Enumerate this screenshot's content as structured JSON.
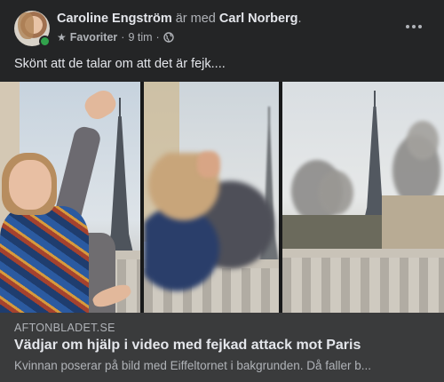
{
  "post": {
    "author": "Caroline Engström",
    "with_text": " är med ",
    "tagged": "Carl Norberg",
    "period": ".",
    "favorite_label": "Favoriter",
    "separator": "·",
    "time": "9 tim",
    "text": "Skönt att de talar om att det är fejk....",
    "online": true
  },
  "link_preview": {
    "domain": "AFTONBLADET.SE",
    "title": "Vädjar om hjälp i video med fejkad attack mot Paris",
    "description": "Kvinnan poserar på bild med Eiffeltornet i bakgrunden. Då faller b..."
  },
  "icons": {
    "favorite": "star-icon",
    "audience": "globe-icon",
    "more": "more-horizontal-icon"
  },
  "colors": {
    "background": "#242526",
    "link_preview_bg": "#3a3b3c",
    "online": "#31a24c"
  }
}
